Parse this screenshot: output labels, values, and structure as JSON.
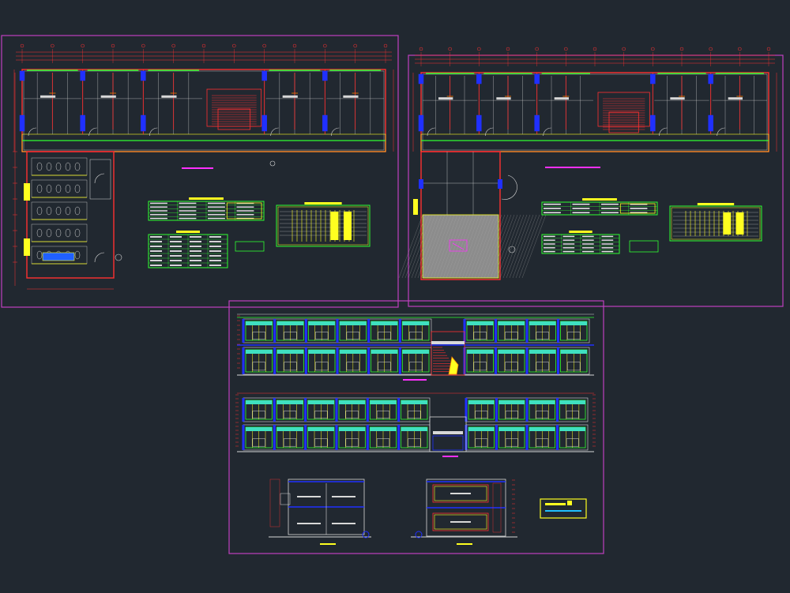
{
  "app": {
    "background": "#212830",
    "sheet_frame_color": "#c040c0",
    "palette": {
      "wall_red": "#ff3030",
      "column_blue": "#2030ff",
      "green": "#30ff30",
      "yellow": "#ffff20",
      "white_grid": "#d8d8d8",
      "magenta": "#ff30ff",
      "orange": "#ff8000"
    }
  },
  "sheets": [
    {
      "id": "ground-floor-plan",
      "content": "plan-ground"
    },
    {
      "id": "upper-floor-plan",
      "content": "plan-upper"
    },
    {
      "id": "elevations-sections",
      "content": "elevations"
    }
  ],
  "tables": [
    {
      "id": "schedule-doors-ground",
      "color": "#30ff30"
    },
    {
      "id": "schedule-windows-ground",
      "color": "#30ff30"
    },
    {
      "id": "legend-ground",
      "color": "#ffff20"
    },
    {
      "id": "schedule-doors-upper",
      "color": "#30ff30"
    },
    {
      "id": "schedule-windows-upper",
      "color": "#30ff30"
    },
    {
      "id": "legend-upper",
      "color": "#ffff20"
    }
  ],
  "title_block": {
    "color": "#ffff20",
    "accent": "#20c0ff"
  }
}
